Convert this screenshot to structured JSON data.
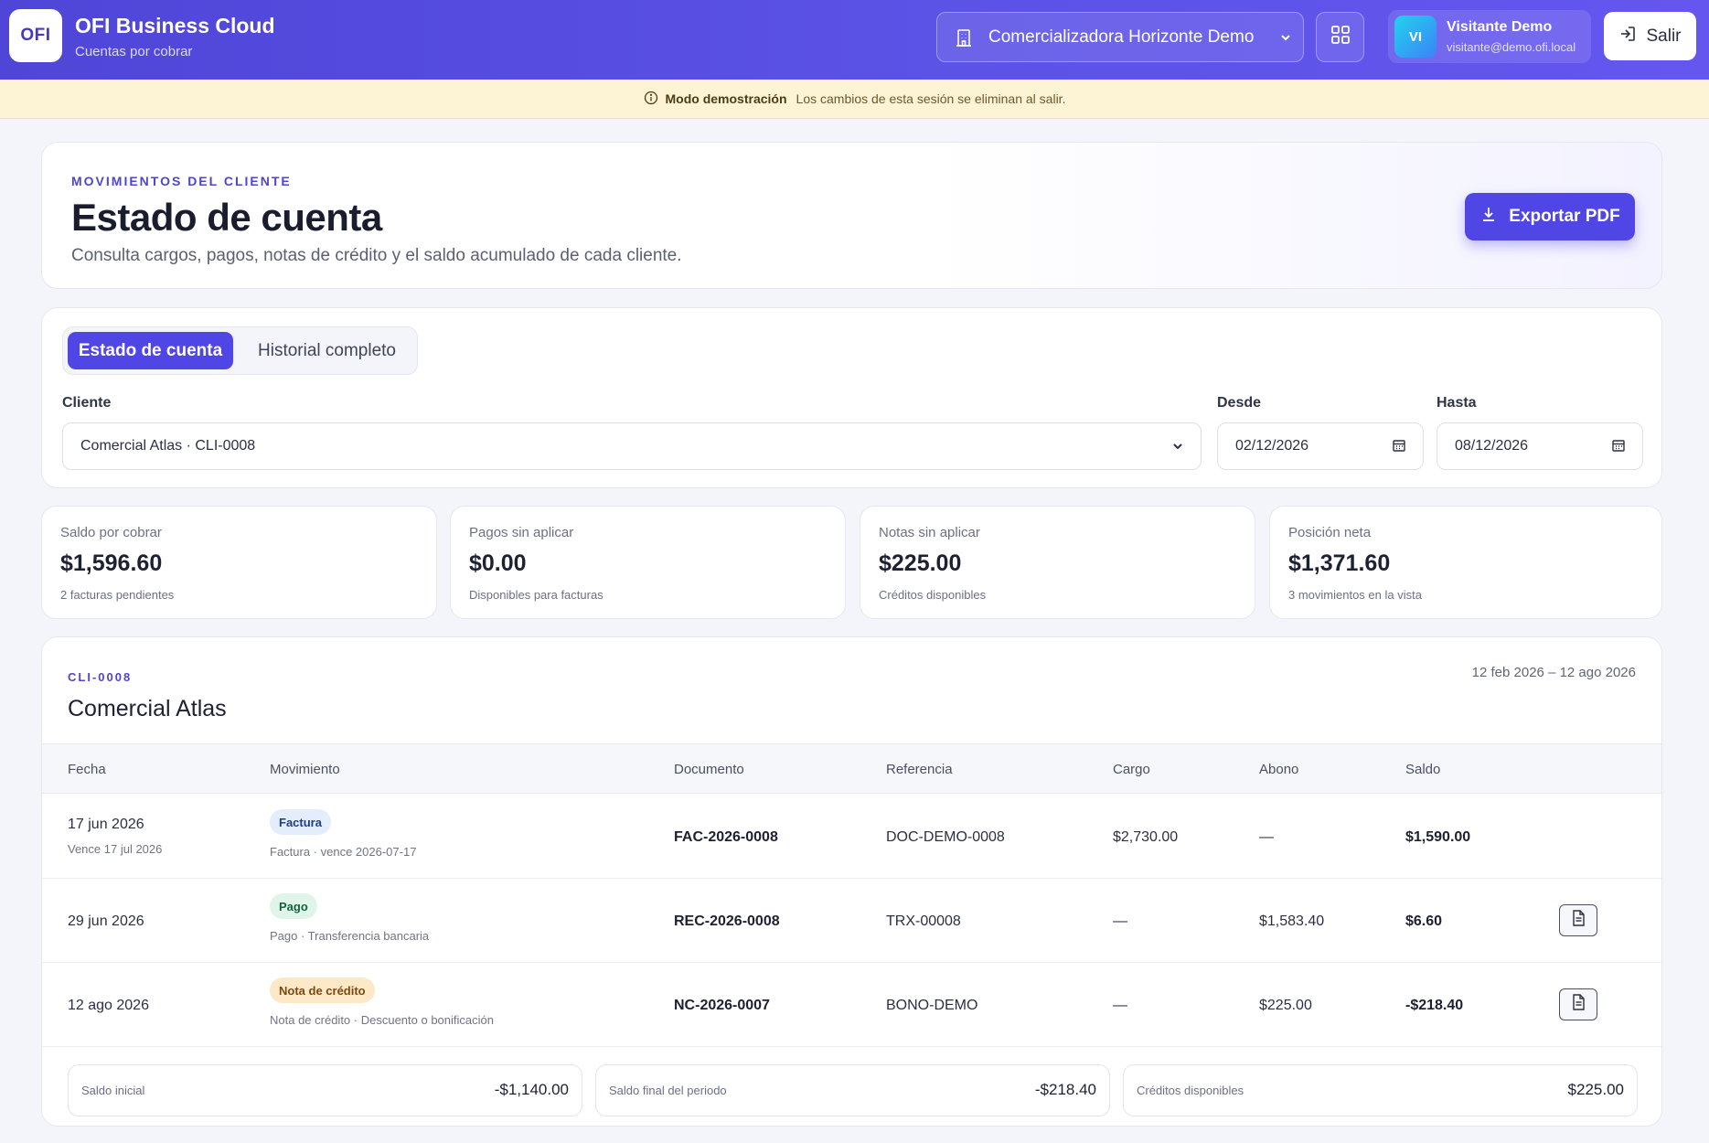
{
  "app": {
    "logo_text": "OFI",
    "title": "OFI Business Cloud",
    "subtitle": "Cuentas por cobrar"
  },
  "header": {
    "company": "Comercializadora Horizonte Demo",
    "user_initials": "VI",
    "user_name": "Visitante Demo",
    "user_email": "visitante@demo.ofi.local",
    "logout_label": "Salir"
  },
  "banner": {
    "title": "Modo demostración",
    "text": "Los cambios de esta sesión se eliminan al salir."
  },
  "page": {
    "eyebrow": "MOVIMIENTOS DEL CLIENTE",
    "title": "Estado de cuenta",
    "description": "Consulta cargos, pagos, notas de crédito y el saldo acumulado de cada cliente.",
    "export_label": "Exportar PDF"
  },
  "filters": {
    "tabs": [
      {
        "label": "Estado de cuenta",
        "active": true
      },
      {
        "label": "Historial completo",
        "active": false
      }
    ],
    "client_label": "Cliente",
    "client_value": "Comercial Atlas · CLI-0008",
    "from_label": "Desde",
    "from_value": "02/12/2026",
    "to_label": "Hasta",
    "to_value": "08/12/2026"
  },
  "kpis": [
    {
      "label": "Saldo por cobrar",
      "value": "$1,596.60",
      "note": "2 facturas pendientes"
    },
    {
      "label": "Pagos sin aplicar",
      "value": "$0.00",
      "note": "Disponibles para facturas"
    },
    {
      "label": "Notas sin aplicar",
      "value": "$225.00",
      "note": "Créditos disponibles"
    },
    {
      "label": "Posición neta",
      "value": "$1,371.60",
      "note": "3 movimientos en la vista"
    }
  ],
  "statement": {
    "client_code": "CLI-0008",
    "client_name": "Comercial Atlas",
    "date_range": "12 feb 2026 – 12 ago 2026",
    "columns": [
      "Fecha",
      "Movimiento",
      "Documento",
      "Referencia",
      "Cargo",
      "Abono",
      "Saldo"
    ],
    "rows": [
      {
        "date": "17 jun 2026",
        "date_sub": "Vence 17 jul 2026",
        "badge": "Factura",
        "detail": "Factura · vence 2026-07-17",
        "document": "FAC-2026-0008",
        "reference": "DOC-DEMO-0008",
        "charge": "$2,730.00",
        "credit": "—",
        "balance": "$1,590.00"
      },
      {
        "date": "29 jun 2026",
        "date_sub": "",
        "badge": "Pago",
        "detail": "Pago · Transferencia bancaria",
        "document": "REC-2026-0008",
        "reference": "TRX-00008",
        "charge": "—",
        "credit": "$1,583.40",
        "balance": "$6.60"
      },
      {
        "date": "12 ago 2026",
        "date_sub": "",
        "badge": "Nota de crédito",
        "detail": "Nota de crédito · Descuento o bonificación",
        "document": "NC-2026-0007",
        "reference": "BONO-DEMO",
        "charge": "—",
        "credit": "$225.00",
        "balance": "-$218.40"
      }
    ],
    "summary": [
      {
        "label": "Saldo inicial",
        "value": "-$1,140.00"
      },
      {
        "label": "Saldo final del periodo",
        "value": "-$218.40"
      },
      {
        "label": "Créditos disponibles",
        "value": "$225.00"
      }
    ]
  },
  "colors": {
    "primary": "#4f46e5",
    "banner_bg": "#fdf4d6",
    "invoice_badge": "#e3edfb",
    "payment_badge": "#dff5ea",
    "credit_badge": "#fde8c8"
  },
  "icons": [
    "building-icon",
    "chevron-down-icon",
    "apps-grid-icon",
    "logout-icon",
    "info-icon",
    "download-icon",
    "calendar-icon",
    "document-icon"
  ]
}
